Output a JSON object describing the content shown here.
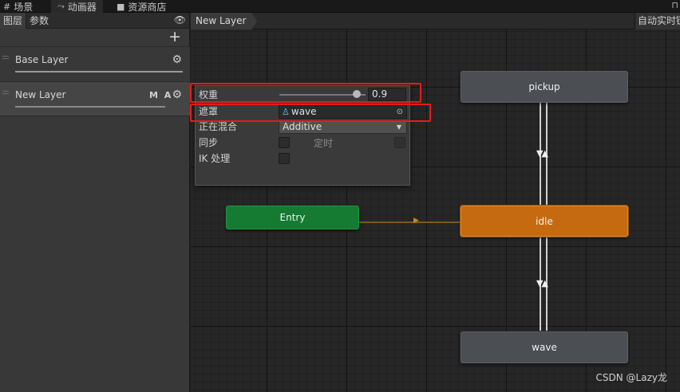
{
  "top_tabs": [
    {
      "icon": "grid-icon",
      "label": "场景"
    },
    {
      "icon": "animator-icon",
      "label": "动画器"
    },
    {
      "icon": "store-icon",
      "label": "资源商店"
    }
  ],
  "left_panel": {
    "tabs": [
      "图层",
      "参数"
    ],
    "active_tab": "图层",
    "layers": [
      {
        "name": "Base Layer",
        "badges": ""
      },
      {
        "name": "New Layer",
        "badges": "M A"
      }
    ]
  },
  "graph": {
    "breadcrumb": "New Layer",
    "auto_live_label": "自动实时链接",
    "states": {
      "pickup": "pickup",
      "entry": "Entry",
      "idle": "idle",
      "wave": "wave"
    },
    "transition_glyph": "▼▲"
  },
  "layer_settings": {
    "weight_label": "权重",
    "weight_value": "0.9",
    "weight_fraction": 0.9,
    "mask_label": "遮罩",
    "mask_value": "wave",
    "blending_label": "正在混合",
    "blending_value": "Additive",
    "sync_label": "同步",
    "timing_label": "定时",
    "ik_label": "IK 处理"
  },
  "colors": {
    "entry_state": "#157a32",
    "default_state": "#c56a10",
    "highlight": "#e41c1c"
  },
  "watermark": "CSDN @Lazy龙"
}
